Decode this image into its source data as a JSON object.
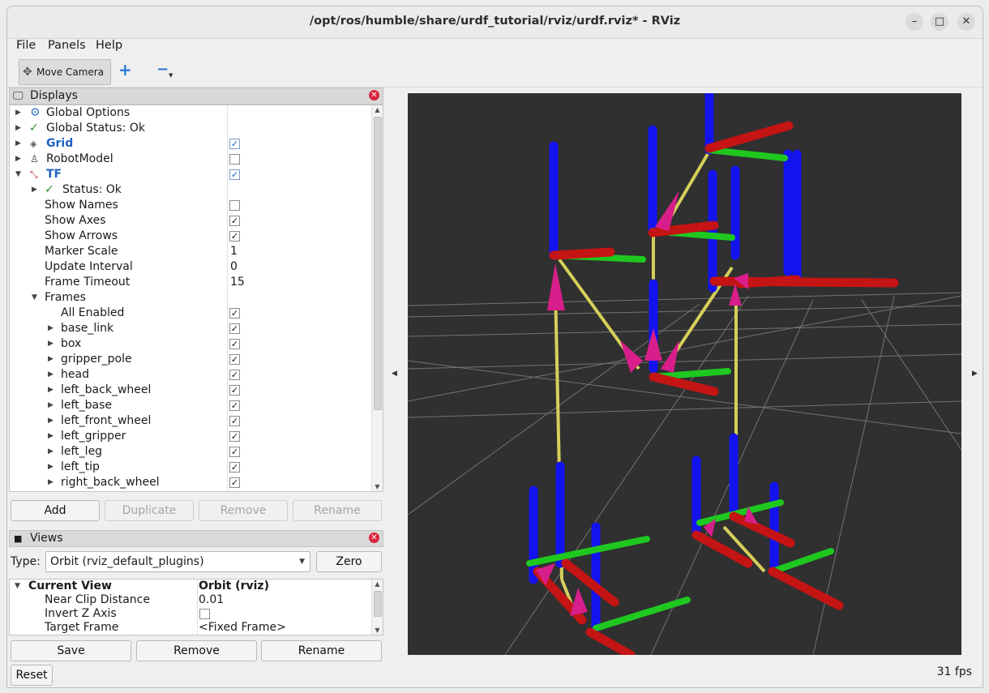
{
  "window": {
    "title": "/opt/ros/humble/share/urdf_tutorial/rviz/urdf.rviz* - RViz",
    "minimize": "–",
    "maximize": "□",
    "close": "✕"
  },
  "menu": {
    "file": "File",
    "panels": "Panels",
    "help": "Help"
  },
  "toolbar": {
    "move_camera": "Move Camera",
    "add_tool": "+",
    "remove_tool": "−"
  },
  "displays": {
    "header": "Displays",
    "close": "✕",
    "rows": [
      {
        "label": "Global Options"
      },
      {
        "label": "Global Status: Ok"
      },
      {
        "label": "Grid"
      },
      {
        "label": "RobotModel"
      },
      {
        "label": "TF"
      },
      {
        "label": "Status: Ok"
      },
      {
        "label": "Show Names"
      },
      {
        "label": "Show Axes"
      },
      {
        "label": "Show Arrows"
      },
      {
        "label": "Marker Scale",
        "value": "1"
      },
      {
        "label": "Update Interval",
        "value": "0"
      },
      {
        "label": "Frame Timeout",
        "value": "15"
      },
      {
        "label": "Frames"
      },
      {
        "label": "All Enabled"
      },
      {
        "label": "base_link"
      },
      {
        "label": "box"
      },
      {
        "label": "gripper_pole"
      },
      {
        "label": "head"
      },
      {
        "label": "left_back_wheel"
      },
      {
        "label": "left_base"
      },
      {
        "label": "left_front_wheel"
      },
      {
        "label": "left_gripper"
      },
      {
        "label": "left_leg"
      },
      {
        "label": "left_tip"
      },
      {
        "label": "right_back_wheel"
      }
    ],
    "buttons": {
      "add": "Add",
      "duplicate": "Duplicate",
      "remove": "Remove",
      "rename": "Rename"
    }
  },
  "views": {
    "header": "Views",
    "close": "✕",
    "type_label": "Type:",
    "type_value": "Orbit (rviz_default_plugins)",
    "zero": "Zero",
    "rows": [
      {
        "label": "Current View",
        "value": "Orbit (rviz)"
      },
      {
        "label": "Near Clip Distance",
        "value": "0.01"
      },
      {
        "label": "Invert Z Axis",
        "value": ""
      },
      {
        "label": "Target Frame",
        "value": "<Fixed Frame>"
      }
    ],
    "buttons": {
      "save": "Save",
      "remove": "Remove",
      "rename": "Rename"
    }
  },
  "reset": "Reset",
  "fps": "31 fps",
  "colors": {
    "x_axis": "#c41414",
    "y_axis": "#1fc81f",
    "z_axis": "#1313ee",
    "arrow": "#d81e8a",
    "link_line": "#d6cf5a",
    "viewport_bg": "#303030"
  }
}
